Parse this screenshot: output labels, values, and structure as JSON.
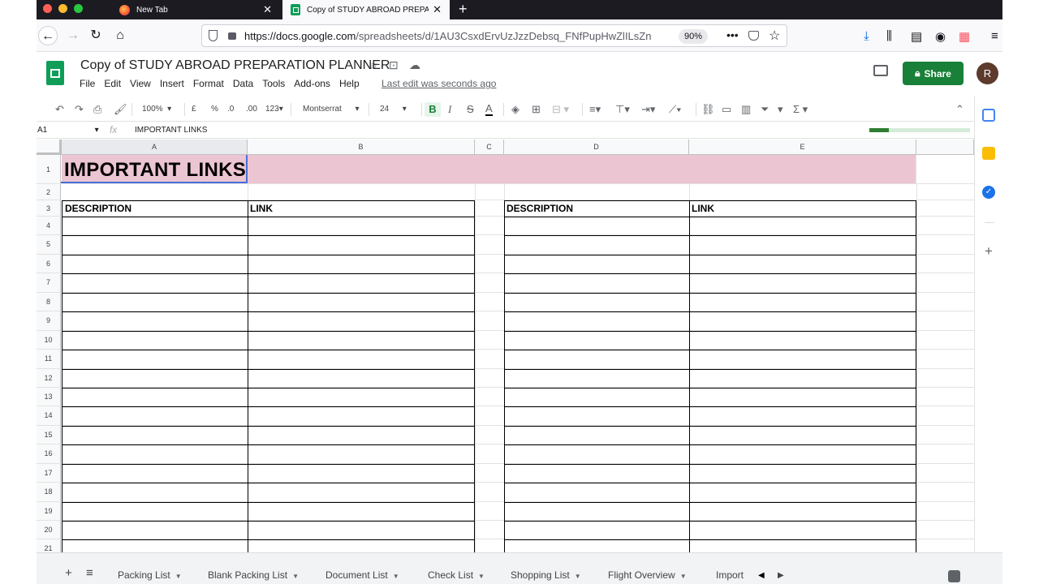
{
  "browser": {
    "tabs": [
      {
        "label": "New Tab"
      },
      {
        "label": "Copy of STUDY ABROAD PREPA"
      }
    ],
    "new_tab": "+",
    "url_host": "https://docs.google.com",
    "url_path": "/spreadsheets/d/1AU3CsxdErvUzJzzDebsq_FNfPupHwZlILsZn",
    "zoom": "90%"
  },
  "doc": {
    "title": "Copy of STUDY ABROAD PREPARATION PLANNER",
    "menu": [
      "File",
      "Edit",
      "View",
      "Insert",
      "Format",
      "Data",
      "Tools",
      "Add-ons",
      "Help"
    ],
    "last_edit": "Last edit was seconds ago",
    "share_label": "Share",
    "avatar_initial": "R"
  },
  "toolbar": {
    "zoom": "100%",
    "currency": "£",
    "percent": "%",
    "dec_less": ".0",
    "dec_more": ".00",
    "format_more": "123",
    "font": "Montserrat",
    "font_size": "24",
    "bold": "B",
    "italic": "I",
    "strike": "S",
    "text_color": "A",
    "sum": "Σ"
  },
  "formula_bar": {
    "cell_ref": "A1",
    "fx": "fx",
    "value": "IMPORTANT LINKS"
  },
  "sheet": {
    "columns": [
      "A",
      "B",
      "C",
      "D",
      "E"
    ],
    "rows": [
      "1",
      "2",
      "3",
      "4",
      "5",
      "6",
      "7",
      "8",
      "9",
      "10",
      "11",
      "12",
      "13",
      "14",
      "15",
      "16",
      "17",
      "18",
      "19",
      "20",
      "21"
    ],
    "title": "IMPORTANT LINKS",
    "table_left": {
      "desc_header": "DESCRIPTION",
      "link_header": "LINK"
    },
    "table_right": {
      "desc_header": "DESCRIPTION",
      "link_header": "LINK"
    },
    "title_band_color": "#ecc5d3"
  },
  "sheet_tabs": [
    "Packing List",
    "Blank Packing List",
    "Document List",
    "Check List",
    "Shopping List",
    "Flight Overview",
    "Import"
  ],
  "colors": {
    "share_green": "#188038",
    "sheets_green": "#0f9d58",
    "selection_blue": "#4a6fd9"
  }
}
